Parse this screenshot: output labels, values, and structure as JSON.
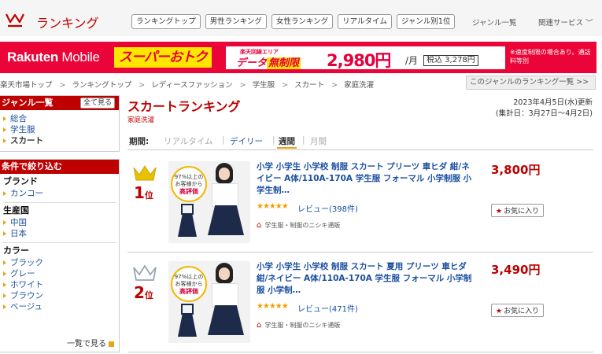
{
  "header": {
    "logo_text": "ランキング",
    "tabs": [
      "ランキングトップ",
      "男性ランキング",
      "女性ランキング",
      "リアルタイム",
      "ジャンル別1位"
    ],
    "genre_list": "ジャンル一覧",
    "related_services": "関連サービス ﹀"
  },
  "banner": {
    "brand_bold": "Rakuten",
    "brand_thin": " Mobile",
    "super": "スーパーおトク",
    "small": "楽天回線エリア",
    "data_label": "データ",
    "data_unlimited": "無制限",
    "price": "2,980円",
    "unit": "/月",
    "tax": "税込 3,278円",
    "note": "※速度制限の場合あり。通話料等別"
  },
  "breadcrumb": [
    "楽天市場トップ",
    "ランキングトップ",
    "レディースファッション",
    "学生服",
    "スカート",
    "家庭洗濯"
  ],
  "genre_rank_link": "このジャンルのランキング一覧 >>",
  "sidebar": {
    "genre_head": "ジャンル一覧",
    "see_all": "全て見る",
    "genres": [
      "総合",
      "学生服",
      "スカート"
    ],
    "filter_head": "条件で絞り込む",
    "brand_head": "ブランド",
    "brands": [
      "カンコー"
    ],
    "country_head": "生産国",
    "countries": [
      "中国",
      "日本"
    ],
    "color_head": "カラー",
    "colors": [
      "ブラック",
      "グレー",
      "ホワイト",
      "ブラウン",
      "ベージュ"
    ],
    "more": "一覧で見る"
  },
  "main": {
    "title": "スカートランキング",
    "subtitle": "家庭洗濯",
    "updated": "2023年4月5日(水)更新",
    "period_range": "(集計日：3月27日〜4月2日)",
    "period_label": "期間:",
    "periods": [
      "リアルタイム",
      "デイリー",
      "週間",
      "月間"
    ]
  },
  "items": [
    {
      "rank": "1",
      "rank_suffix": "位",
      "badge_pct": "97%以上の",
      "badge_text": "お客様から",
      "badge_hi": "高評価",
      "title": "小学 小学生 小学校 制服 スカート プリーツ 車ヒダ 紺/ネイビー A体/110A-170A 学生服 フォーマル 小学制服 小学生制…",
      "stars": "★★★★★",
      "review": "レビュー(398件)",
      "shop": "学生服・制服のニシキ通販",
      "price": "3,800円",
      "fav": "お気に入り"
    },
    {
      "rank": "2",
      "rank_suffix": "位",
      "badge_pct": "97%以上の",
      "badge_text": "お客様から",
      "badge_hi": "高評価",
      "title": "小学 小学生 小学校 制服 スカート 夏用 プリーツ 車ヒダ 紺/ネイビー A体/110A-170A 学生服 フォーマル 小学制服 小学制…",
      "stars": "★★★★★",
      "review": "レビュー(471件)",
      "shop": "学生服・制服のニシキ通販",
      "price": "3,490円",
      "fav": "お気に入り"
    }
  ],
  "colors": {
    "accent": "#bf0000",
    "banner": "#ea0437",
    "link": "#1a4fa0",
    "gold": "#e8a317"
  }
}
